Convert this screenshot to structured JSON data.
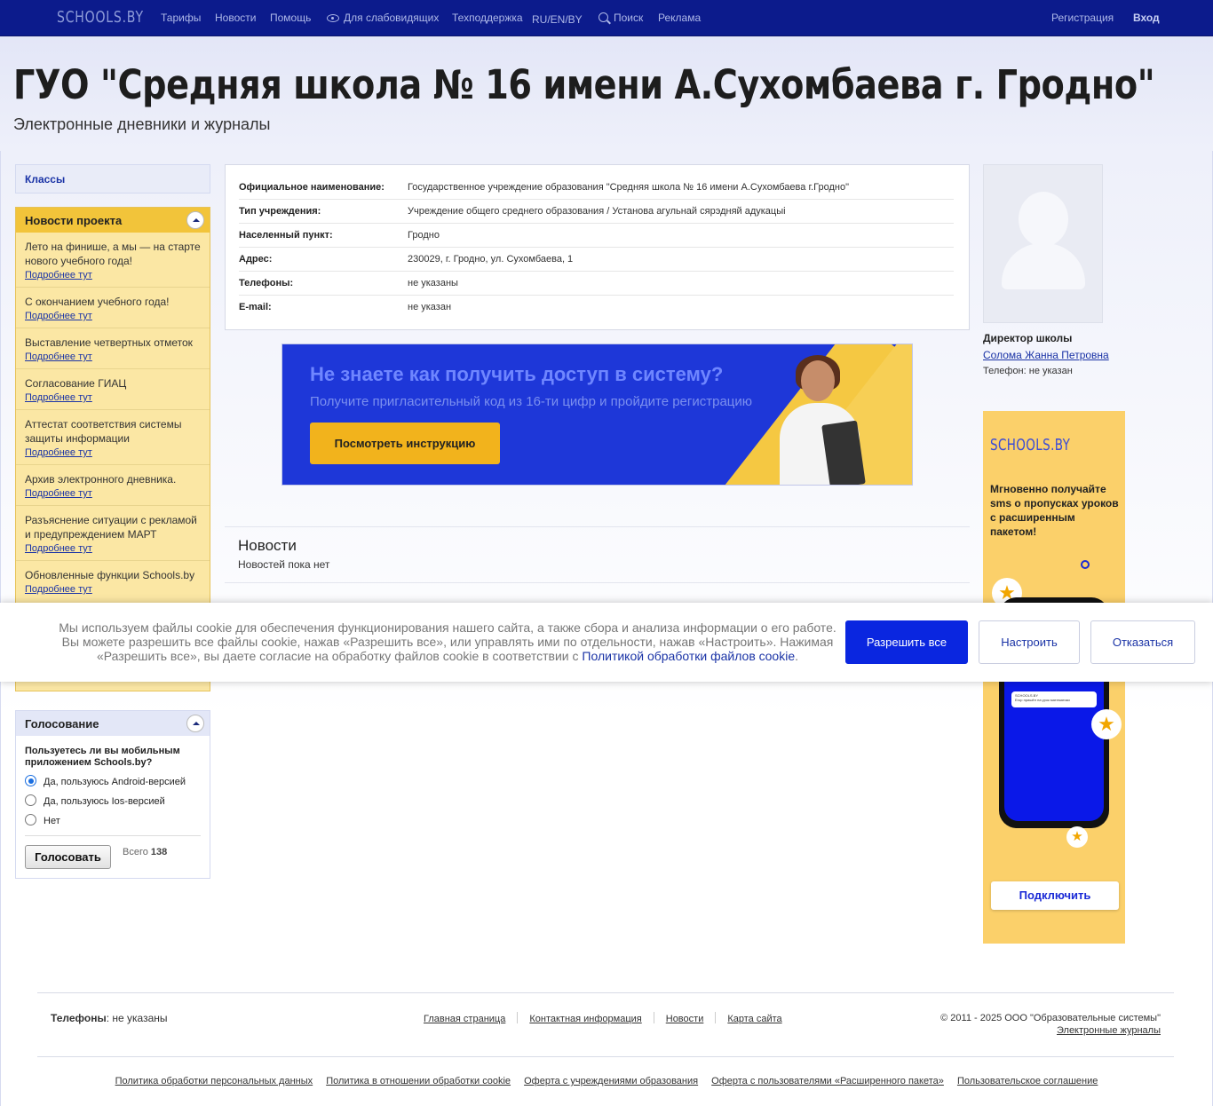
{
  "topnav": {
    "logo": "SCHOOLS.BY",
    "items": [
      "Тарифы",
      "Новости",
      "Помощь",
      "Для слабовидящих",
      "Техподдержка",
      "RU/EN/BY",
      "Поиск",
      "Реклама"
    ],
    "register": "Регистрация",
    "login": "Вход"
  },
  "header": {
    "title": "ГУО \"Средняя школа № 16 имени А.Сухомбаева г. Гродно\"",
    "subtitle": "Электронные дневники и журналы"
  },
  "sidebar": {
    "classes": "Классы",
    "news_title": "Новости проекта",
    "news": [
      {
        "title": "Лето на финише, а мы — на старте нового учебного года!",
        "more": "Подробнее тут"
      },
      {
        "title": "С окончанием учебного года!",
        "more": "Подробнее тут"
      },
      {
        "title": "Выставление четвертных отметок",
        "more": "Подробнее тут"
      },
      {
        "title": "Согласование ГИАЦ",
        "more": "Подробнее тут"
      },
      {
        "title": "Аттестат соответствия системы защиты информации",
        "more": "Подробнее тут"
      },
      {
        "title": "Архив электронного дневника.",
        "more": "Подробнее тут"
      },
      {
        "title": "Разъяснение ситуации с рекламой и предупреждением МАРТ",
        "more": "Подробнее тут"
      },
      {
        "title": "Обновленные функции Schools.by",
        "more": "Подробнее тут"
      }
    ],
    "vote": {
      "title": "Голосование",
      "question": "Пользуетесь ли вы мобильным приложением Schools.by?",
      "options": [
        "Да, пользуюсь Android-версией",
        "Да, пользуюсь Ios-версией",
        "Нет"
      ],
      "selected_index": 0,
      "button": "Голосовать",
      "total_label": "Всего",
      "total": "138"
    }
  },
  "info": [
    {
      "key": "Официальное наименование:",
      "value": "Государственное учреждение образования \"Средняя школа № 16 имени А.Сухомбаева г.Гродно\""
    },
    {
      "key": "Тип учреждения:",
      "value": "Учреждение общего среднего образования / Установа агульнай сярэдняй адукацыі"
    },
    {
      "key": "Населенный пункт:",
      "value": "Гродно"
    },
    {
      "key": "Адрес:",
      "value": "230029, г. Гродно, ул. Сухомбаева, 1"
    },
    {
      "key": "Телефоны:",
      "value": "не указаны"
    },
    {
      "key": "E-mail:",
      "value": "не указан"
    }
  ],
  "banner": {
    "heading": "Не знаете как получить доступ в систему?",
    "subheading": "Получите пригласительный код из 16-ти цифр и пройдите регистрацию",
    "button": "Посмотреть инструкцию"
  },
  "news_section": {
    "title": "Новости",
    "empty": "Новостей пока нет"
  },
  "director": {
    "label": "Директор школы",
    "name": "Солома Жанна Петровна",
    "phone": "Телефон: не указан"
  },
  "ad": {
    "logo": "SCHOOLS.BY",
    "text": "Мгновенно получайте sms о пропусках уроков с расширенным пакетом!",
    "phone_app": "SCHOOLS.BY",
    "phone_msg": "Егор пришёл на урок математики",
    "button": "Подключить"
  },
  "cookie": {
    "text": "Мы используем файлы cookie для обеспечения функционирования нашего сайта, а также сбора и анализа информации о его работе. Вы можете разрешить все файлы cookie, нажав «Разрешить все», или управлять ими по отдельности, нажав «Настроить». Нажимая «Разрешить все», вы даете согласие на обработку файлов cookie в соответствии с",
    "link": "Политикой обработки файлов cookie",
    "allow": "Разрешить все",
    "configure": "Настроить",
    "decline": "Отказаться"
  },
  "footer": {
    "phones_label": "Телефоны",
    "phones_value": ": не указаны",
    "links": [
      "Главная страница",
      "Контактная информация",
      "Новости",
      "Карта сайта"
    ],
    "copyright": "© 2011 - 2025 ООО \"Образовательные системы\"",
    "journals": "Электронные журналы",
    "legal": [
      "Политика обработки персональных данных",
      "Политика в отношении обработки cookie",
      "Оферта с учреждениями образования",
      "Оферта с пользователями «Расширенного пакета»",
      "Пользовательское соглашение"
    ]
  }
}
